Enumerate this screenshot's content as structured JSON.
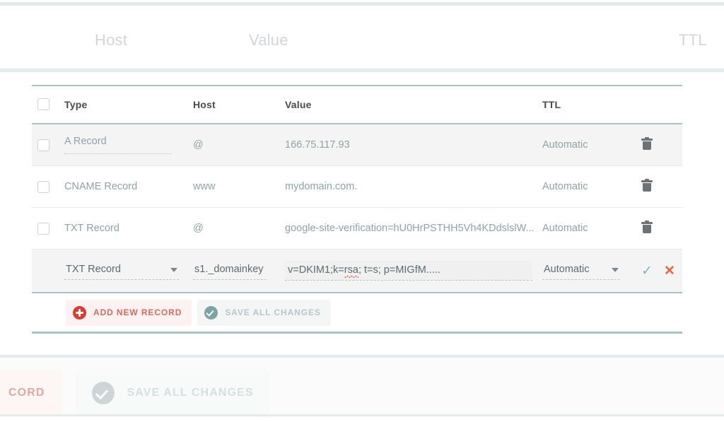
{
  "ghost_header": {
    "host_label": "Host",
    "value_label": "Value",
    "ttl_label": "TTL"
  },
  "table": {
    "headers": {
      "type": "Type",
      "host": "Host",
      "value": "Value",
      "ttl": "TTL"
    },
    "rows": [
      {
        "type": "A Record",
        "host": "@",
        "value": "166.75.117.93",
        "ttl": "Automatic",
        "delete_icon": "trash-icon"
      },
      {
        "type": "CNAME Record",
        "host": "www",
        "value": "mydomain.com.",
        "ttl": "Automatic",
        "delete_icon": "trash-icon"
      },
      {
        "type": "TXT Record",
        "host": "@",
        "value": "google-site-verification=hU0HrPSTHH5Vh4KDdslslW...",
        "ttl": "Automatic",
        "delete_icon": "trash-icon"
      }
    ],
    "editing_row": {
      "type_value": "TXT Record",
      "host_value": "s1._domainkey",
      "value_part_a": "v=DKIM1;k=",
      "value_misspelled": "rsa",
      "value_part_b": "; t=s; p=MIGfM.....",
      "value_full": "v=DKIM1;k=rsa; t=s; p=MIGfM.....",
      "ttl_value": "Automatic",
      "confirm_glyph": "✓",
      "cancel_glyph": "✕"
    }
  },
  "actions": {
    "add_label": "ADD NEW RECORD",
    "save_label": "SAVE ALL CHANGES",
    "add_icon": "circle-plus-icon",
    "save_icon": "circle-check-icon"
  },
  "bottom_bar": {
    "add_label": "CORD",
    "save_label": "SAVE ALL CHANGES",
    "add_icon": "circle-plus-icon",
    "save_icon": "circle-check-icon"
  },
  "colors": {
    "rule_teal": "#a8c4c4",
    "band_teal": "#e2ecec",
    "accent_red": "#e0392b",
    "accent_teal": "#7ba3a8",
    "cancel_orange": "#ec6440",
    "text_muted": "#8fa2a8"
  }
}
